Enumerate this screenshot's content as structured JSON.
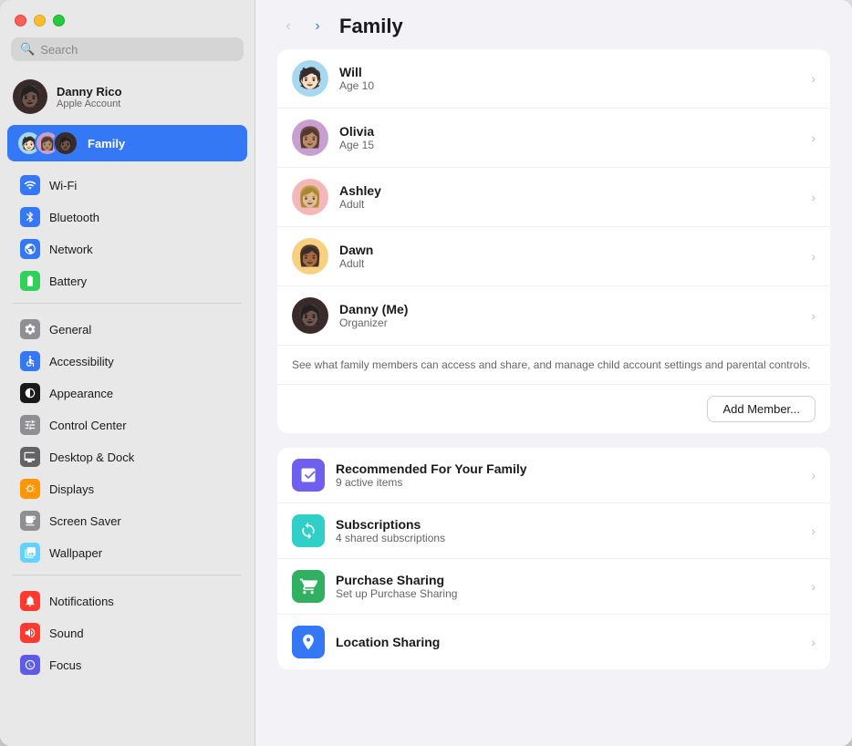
{
  "window": {
    "title": "Family"
  },
  "trafficLights": {
    "close": "close",
    "minimize": "minimize",
    "maximize": "maximize"
  },
  "search": {
    "placeholder": "Search"
  },
  "account": {
    "name": "Danny Rico",
    "subtitle": "Apple Account",
    "avatarEmoji": "🧑🏿"
  },
  "family": {
    "label": "Family",
    "avatars": [
      "🧑🏻",
      "👩🏽",
      "👩🏼"
    ]
  },
  "sidebar": {
    "sections": [
      {
        "items": [
          {
            "id": "wifi",
            "label": "Wi-Fi",
            "iconClass": "icon-wifi",
            "icon": "📶"
          },
          {
            "id": "bluetooth",
            "label": "Bluetooth",
            "iconClass": "icon-bluetooth",
            "icon": "🔷"
          },
          {
            "id": "network",
            "label": "Network",
            "iconClass": "icon-network",
            "icon": "🌐"
          },
          {
            "id": "battery",
            "label": "Battery",
            "iconClass": "icon-battery",
            "icon": "🔋"
          }
        ]
      },
      {
        "items": [
          {
            "id": "general",
            "label": "General",
            "iconClass": "icon-general",
            "icon": "⚙️"
          },
          {
            "id": "accessibility",
            "label": "Accessibility",
            "iconClass": "icon-accessibility",
            "icon": "♿"
          },
          {
            "id": "appearance",
            "label": "Appearance",
            "iconClass": "icon-appearance",
            "icon": "🌓"
          },
          {
            "id": "control",
            "label": "Control Center",
            "iconClass": "icon-control",
            "icon": "🎛"
          },
          {
            "id": "desktop",
            "label": "Desktop & Dock",
            "iconClass": "icon-desktop",
            "icon": "🖥"
          },
          {
            "id": "displays",
            "label": "Displays",
            "iconClass": "icon-displays",
            "icon": "☀️"
          },
          {
            "id": "screensaver",
            "label": "Screen Saver",
            "iconClass": "icon-screensaver",
            "icon": "🌁"
          },
          {
            "id": "wallpaper",
            "label": "Wallpaper",
            "iconClass": "icon-wallpaper",
            "icon": "❄️"
          }
        ]
      },
      {
        "items": [
          {
            "id": "notifications",
            "label": "Notifications",
            "iconClass": "icon-notifications",
            "icon": "🔔"
          },
          {
            "id": "sound",
            "label": "Sound",
            "iconClass": "icon-sound",
            "icon": "🔊"
          },
          {
            "id": "focus",
            "label": "Focus",
            "iconClass": "icon-focus",
            "icon": "🌙"
          }
        ]
      }
    ]
  },
  "mainTitle": "Family",
  "members": [
    {
      "id": "will",
      "name": "Will",
      "role": "Age 10",
      "avatarClass": "avatar-will",
      "emoji": "🧑🏻"
    },
    {
      "id": "olivia",
      "name": "Olivia",
      "role": "Age 15",
      "avatarClass": "avatar-olivia",
      "emoji": "👩🏽"
    },
    {
      "id": "ashley",
      "name": "Ashley",
      "role": "Adult",
      "avatarClass": "avatar-ashley",
      "emoji": "👩🏼"
    },
    {
      "id": "dawn",
      "name": "Dawn",
      "role": "Adult",
      "avatarClass": "avatar-dawn",
      "emoji": "👩🏾"
    },
    {
      "id": "danny",
      "name": "Danny (Me)",
      "role": "Organizer",
      "avatarClass": "avatar-danny",
      "emoji": "🧑🏿"
    }
  ],
  "infoText": "See what family members can access and share, and manage child account settings and parental controls.",
  "addMemberLabel": "Add Member...",
  "features": [
    {
      "id": "recommended",
      "name": "Recommended For Your Family",
      "sub": "9 active items",
      "iconClass": "feature-icon-recommended",
      "icon": "📋"
    },
    {
      "id": "subscriptions",
      "name": "Subscriptions",
      "sub": "4 shared subscriptions",
      "iconClass": "feature-icon-subscriptions",
      "icon": "↻"
    },
    {
      "id": "purchase",
      "name": "Purchase Sharing",
      "sub": "Set up Purchase Sharing",
      "iconClass": "feature-icon-purchase",
      "icon": "P"
    },
    {
      "id": "location",
      "name": "Location Sharing",
      "sub": "",
      "iconClass": "feature-icon-location",
      "icon": "➤"
    }
  ]
}
